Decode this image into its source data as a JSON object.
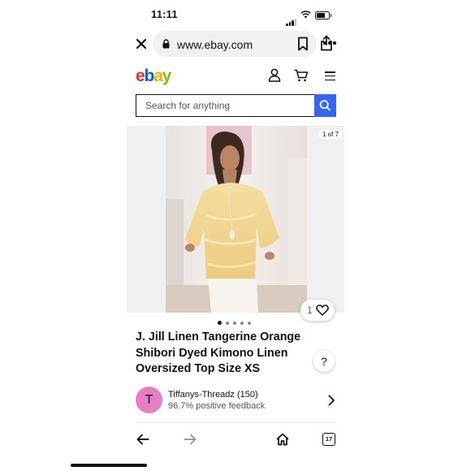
{
  "status_bar": {
    "time": "11:11"
  },
  "browser": {
    "url": "www.ebay.com",
    "open_tabs": "17"
  },
  "header": {
    "logo": [
      "e",
      "b",
      "a",
      "y"
    ],
    "colors": {
      "e": "#e53238",
      "b": "#0064d2",
      "a": "#f5af02",
      "y": "#86b817"
    }
  },
  "search": {
    "placeholder": "Search for anything",
    "button_color": "#3665f3"
  },
  "gallery": {
    "counter": "1 of 7",
    "watch_count": "1",
    "dots_total": 5,
    "dots_active": 1
  },
  "listing": {
    "title": "J. Jill Linen Tangerine Orange Shibori Dyed Kimono Linen Oversized Top Size XS",
    "help": "?"
  },
  "seller": {
    "initial": "T",
    "name": "Tiffanys-Threadz (150)",
    "feedback": "96.7% positive feedback",
    "avatar_color": "#e37fc3"
  },
  "icons": [
    "close-icon",
    "lock-icon",
    "bookmark-icon",
    "share-icon",
    "more-icon",
    "user-icon",
    "cart-icon",
    "menu-icon",
    "search-icon",
    "heart-icon",
    "chevron-right-icon",
    "back-icon",
    "forward-icon",
    "home-icon",
    "tabs-icon"
  ]
}
